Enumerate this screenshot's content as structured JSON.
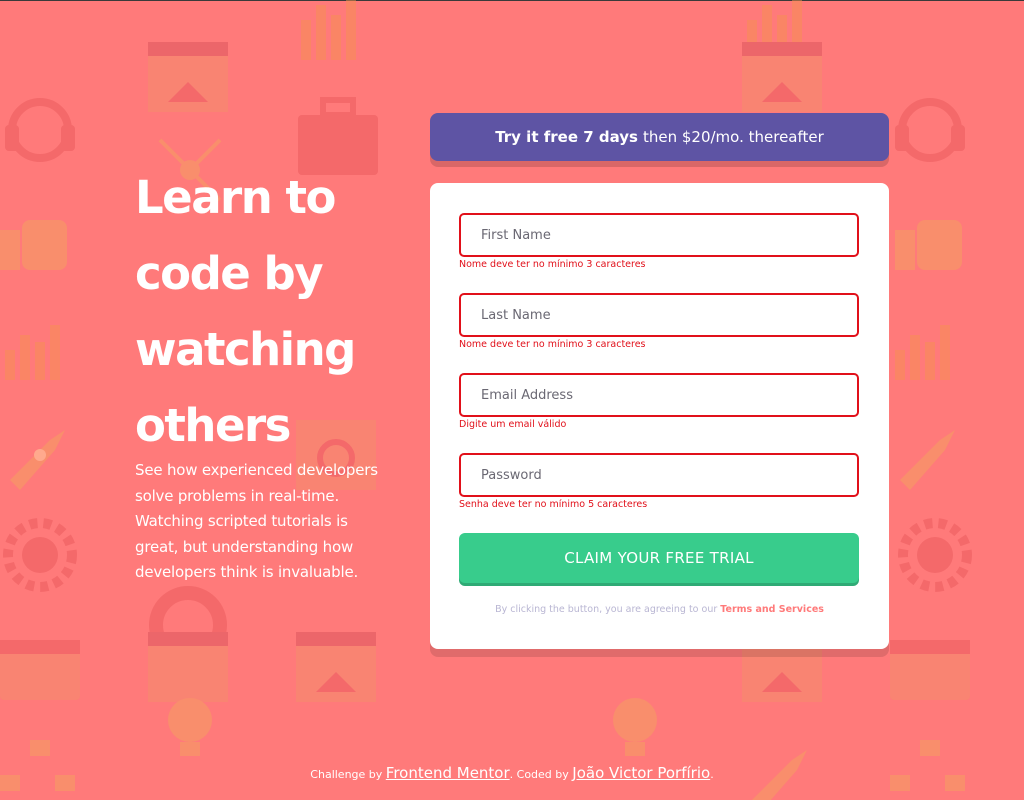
{
  "hero": {
    "title": "Learn to code by watching others",
    "description": "See how experienced developers solve problems in real-time. Watching scripted tutorials is great, but understanding how developers think is invaluable."
  },
  "banner": {
    "bold": "Try it free 7 days",
    "rest": "then $20/mo. thereafter"
  },
  "form": {
    "first_name": {
      "placeholder": "First Name",
      "value": "",
      "error": "Nome deve ter no mínimo 3 caracteres"
    },
    "last_name": {
      "placeholder": "Last Name",
      "value": "",
      "error": "Nome deve ter no mínimo 3 caracteres"
    },
    "email": {
      "placeholder": "Email Address",
      "value": "",
      "error": "Digite um email válido"
    },
    "password": {
      "placeholder": "Password",
      "value": "",
      "error": "Senha deve ter no mínimo 5 caracteres"
    },
    "submit_label": "CLAIM YOUR FREE TRIAL",
    "terms_prefix": "By clicking the button, you are agreeing to our",
    "terms_link": "Terms and Services"
  },
  "footer": {
    "challenge_by": "Challenge by",
    "challenge_link": "Frontend Mentor",
    "coded_by": ". Coded by",
    "author_link": "João Victor Porfírio",
    "end": "."
  },
  "colors": {
    "background": "#ff7a7a",
    "banner": "#5e54a4",
    "button": "#38cc8c",
    "error": "#e1101a"
  },
  "icons": [
    "thumbs-up-icon",
    "headset-icon",
    "rocket-icon",
    "globe-gear-icon",
    "calendar-icon",
    "bar-chart-icon",
    "toolbox-icon",
    "lightbulb-icon",
    "house-window-icon",
    "lifebuoy-icon",
    "network-icon",
    "magnifier-icon"
  ]
}
